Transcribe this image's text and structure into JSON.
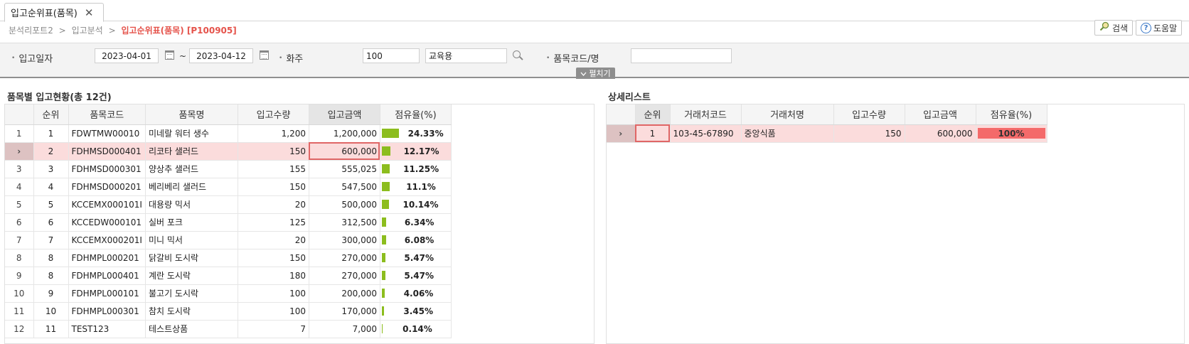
{
  "tab": {
    "title": "입고순위표(품목)",
    "close": "✕"
  },
  "breadcrumb": {
    "items": [
      "분석리포트2",
      "입고분석"
    ],
    "current": "입고순위표(품목) [P100905]",
    "sep": ">"
  },
  "toolbar": {
    "search_label": "검색",
    "help_label": "도움말",
    "help_glyph": "?"
  },
  "filters": {
    "date_label": "입고일자",
    "date_from": "2023-04-01",
    "tilde": "~",
    "date_to": "2023-04-12",
    "owner_label": "화주",
    "owner_code": "100",
    "owner_name": "교육용",
    "item_label": "품목코드/명",
    "item_value": "",
    "fold_label": "펼치기"
  },
  "left": {
    "title": "품목별 입고현황(총 12건)",
    "columns": [
      "순위",
      "품목코드",
      "품목명",
      "입고수량",
      "입고금액",
      "점유율(%)"
    ],
    "rows": [
      {
        "idx": "1",
        "rank": "1",
        "code": "FDWTMW00010",
        "name": "미네랄 워터 생수",
        "qty": "1,200",
        "amount": "1,200,000",
        "share": "24.33%",
        "pct": 24.33
      },
      {
        "idx": "›",
        "rank": "2",
        "code": "FDHMSD000401",
        "name": "리코타 샐러드",
        "qty": "150",
        "amount": "600,000",
        "share": "12.17%",
        "pct": 12.17
      },
      {
        "idx": "3",
        "rank": "3",
        "code": "FDHMSD000301",
        "name": "양상추 샐러드",
        "qty": "155",
        "amount": "555,025",
        "share": "11.25%",
        "pct": 11.25
      },
      {
        "idx": "4",
        "rank": "4",
        "code": "FDHMSD000201",
        "name": "베리베리 샐러드",
        "qty": "150",
        "amount": "547,500",
        "share": "11.1%",
        "pct": 11.1
      },
      {
        "idx": "5",
        "rank": "5",
        "code": "KCCEMX000101I",
        "name": "대용량 믹서",
        "qty": "20",
        "amount": "500,000",
        "share": "10.14%",
        "pct": 10.14
      },
      {
        "idx": "6",
        "rank": "6",
        "code": "KCCEDW000101",
        "name": "실버 포크",
        "qty": "125",
        "amount": "312,500",
        "share": "6.34%",
        "pct": 6.34
      },
      {
        "idx": "7",
        "rank": "7",
        "code": "KCCEMX000201I",
        "name": "미니 믹서",
        "qty": "20",
        "amount": "300,000",
        "share": "6.08%",
        "pct": 6.08
      },
      {
        "idx": "8",
        "rank": "8",
        "code": "FDHMPL000201",
        "name": "닭갈비 도시락",
        "qty": "150",
        "amount": "270,000",
        "share": "5.47%",
        "pct": 5.47
      },
      {
        "idx": "9",
        "rank": "8",
        "code": "FDHMPL000401",
        "name": "계란 도시락",
        "qty": "180",
        "amount": "270,000",
        "share": "5.47%",
        "pct": 5.47
      },
      {
        "idx": "10",
        "rank": "9",
        "code": "FDHMPL000101",
        "name": "불고기 도시락",
        "qty": "100",
        "amount": "200,000",
        "share": "4.06%",
        "pct": 4.06
      },
      {
        "idx": "11",
        "rank": "10",
        "code": "FDHMPL000301",
        "name": "참치 도시락",
        "qty": "100",
        "amount": "170,000",
        "share": "3.45%",
        "pct": 3.45
      },
      {
        "idx": "12",
        "rank": "11",
        "code": "TEST123",
        "name": "테스트상품",
        "qty": "7",
        "amount": "7,000",
        "share": "0.14%",
        "pct": 0.14
      }
    ]
  },
  "right": {
    "title": "상세리스트",
    "columns": [
      "순위",
      "거래처코드",
      "거래처명",
      "입고수량",
      "입고금액",
      "점유율(%)"
    ],
    "rows": [
      {
        "idx": "›",
        "rank": "1",
        "code": "103-45-67890",
        "name": "중앙식품",
        "qty": "150",
        "amount": "600,000",
        "share": "100%",
        "pct": 100
      }
    ]
  },
  "colors": {
    "accent": "#e5534b",
    "bar_green": "#8cbd1e",
    "bar_red": "#f46a6a",
    "selected_row": "#fbdcdc"
  }
}
